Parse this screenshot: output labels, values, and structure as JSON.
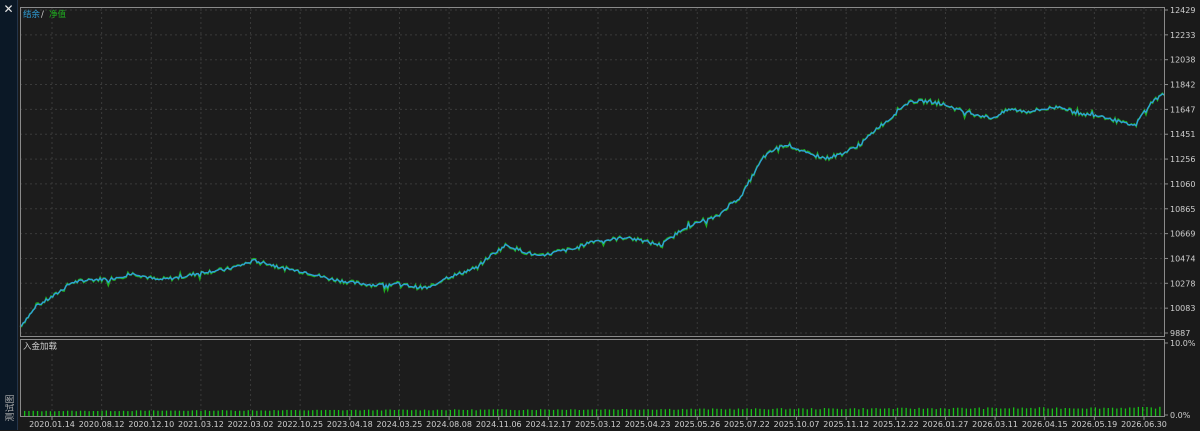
{
  "window": {
    "close_glyph": "✕",
    "side_label": "测试图"
  },
  "colors": {
    "background": "#1c1c1c",
    "grid": "#3a3a3a",
    "border": "#8a8a8a",
    "balance_line": "#2e9fd8",
    "equity_line": "#20b020",
    "deposit_bars": "#18c018",
    "text": "#cfcfcf"
  },
  "chart_data": [
    {
      "type": "line",
      "legend": {
        "balance": "结余",
        "separator": " / ",
        "equity": "净值",
        "placement": "top-left"
      },
      "y_ticks": [
        "12429",
        "12233",
        "12038",
        "11842",
        "11647",
        "11451",
        "11256",
        "11060",
        "10865",
        "10669",
        "10474",
        "10278",
        "10083",
        "9887"
      ],
      "ylim": [
        9887,
        12429
      ],
      "xlim": [
        0,
        100
      ],
      "grid": true,
      "x_dates": [
        "2020.01.14",
        "2020.08.12",
        "2020.12.10",
        "2021.03.12",
        "2022.03.02",
        "2022.10.25",
        "2023.04.18",
        "2024.03.25",
        "2024.08.08",
        "2024.11.06",
        "2024.12.17",
        "2025.03.12",
        "2025.04.23",
        "2025.05.26",
        "2025.07.22",
        "2025.10.07",
        "2025.11.12",
        "2025.12.22",
        "2026.01.27",
        "2026.03.11",
        "2026.04.15",
        "2026.05.19",
        "2026.06.30"
      ],
      "balance_points": [
        [
          0,
          9960
        ],
        [
          1.5,
          10120
        ],
        [
          3,
          10200
        ],
        [
          4.5,
          10300
        ],
        [
          6,
          10320
        ],
        [
          8,
          10330
        ],
        [
          10,
          10370
        ],
        [
          12,
          10320
        ],
        [
          14,
          10340
        ],
        [
          16,
          10380
        ],
        [
          18,
          10400
        ],
        [
          19.5,
          10440
        ],
        [
          20.5,
          10470
        ],
        [
          21.5,
          10450
        ],
        [
          23,
          10410
        ],
        [
          25,
          10380
        ],
        [
          27,
          10330
        ],
        [
          29,
          10300
        ],
        [
          31,
          10280
        ],
        [
          33,
          10290
        ],
        [
          35,
          10260
        ],
        [
          36,
          10260
        ],
        [
          37,
          10330
        ],
        [
          38.5,
          10370
        ],
        [
          40,
          10420
        ],
        [
          41,
          10500
        ],
        [
          42.5,
          10590
        ],
        [
          44,
          10540
        ],
        [
          45.5,
          10500
        ],
        [
          47,
          10540
        ],
        [
          48.5,
          10560
        ],
        [
          50,
          10620
        ],
        [
          51.5,
          10630
        ],
        [
          53,
          10650
        ],
        [
          54.5,
          10620
        ],
        [
          56,
          10590
        ],
        [
          57,
          10650
        ],
        [
          58,
          10720
        ],
        [
          59.5,
          10770
        ],
        [
          61,
          10810
        ],
        [
          62,
          10900
        ],
        [
          63,
          10960
        ],
        [
          64,
          11120
        ],
        [
          65,
          11270
        ],
        [
          66,
          11330
        ],
        [
          67,
          11370
        ],
        [
          68,
          11330
        ],
        [
          69,
          11290
        ],
        [
          70.5,
          11260
        ],
        [
          72,
          11300
        ],
        [
          73.5,
          11370
        ],
        [
          75,
          11500
        ],
        [
          76,
          11560
        ],
        [
          77,
          11650
        ],
        [
          78,
          11700
        ],
        [
          79.5,
          11700
        ],
        [
          81,
          11670
        ],
        [
          82.5,
          11620
        ],
        [
          84,
          11590
        ],
        [
          85,
          11570
        ],
        [
          86.5,
          11640
        ],
        [
          88,
          11620
        ],
        [
          89.5,
          11640
        ],
        [
          91,
          11660
        ],
        [
          92,
          11620
        ],
        [
          93,
          11600
        ],
        [
          94.5,
          11590
        ],
        [
          95.5,
          11560
        ],
        [
          96.5,
          11530
        ],
        [
          97.5,
          11510
        ],
        [
          98,
          11590
        ],
        [
          99,
          11700
        ],
        [
          100,
          11760
        ]
      ]
    },
    {
      "type": "bar",
      "title": "入金加载",
      "y_ticks": [
        "10.0%",
        "0.0%"
      ],
      "ylim": [
        0,
        10
      ],
      "bar_value_range": [
        0.4,
        1.2
      ]
    }
  ]
}
